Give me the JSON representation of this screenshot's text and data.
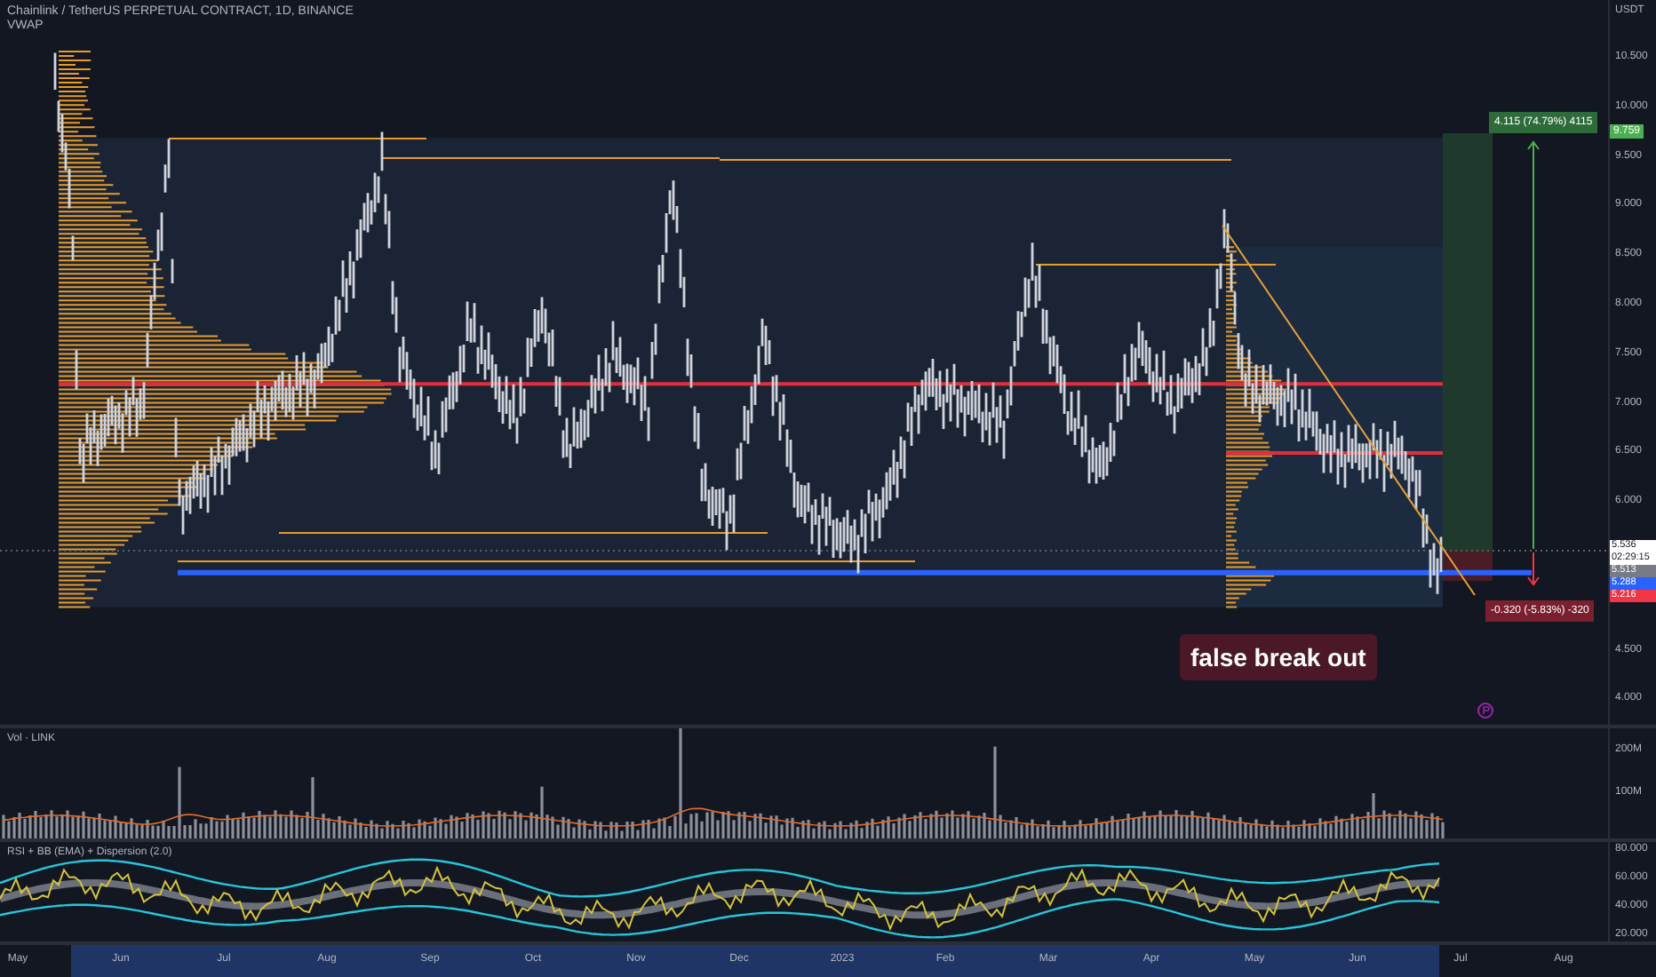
{
  "header": {
    "title": "Chainlink / TetherUS PERPETUAL CONTRACT, 1D, BINANCE",
    "indicator": "VWAP"
  },
  "price_axis": {
    "unit": "USDT",
    "ticks": [
      "10.500",
      "10.000",
      "9.500",
      "9.000",
      "8.500",
      "8.000",
      "7.500",
      "7.000",
      "6.500",
      "6.000",
      "4.500",
      "4.000"
    ]
  },
  "target_tag": {
    "text": "9.759",
    "color": "#4caf50"
  },
  "price_tags": [
    {
      "text": "5.536",
      "subtext": "02:29:15",
      "color": "#ffffff"
    },
    {
      "text": "5.513",
      "color": "#787b86"
    },
    {
      "text": "5.288",
      "color": "#2962ff"
    },
    {
      "text": "5.216",
      "color": "#f23645"
    }
  ],
  "measure": {
    "gain_label": "4.115 (74.79%) 4115",
    "loss_label": "-0.320 (-5.83%) -320"
  },
  "annotation": {
    "text": "false break out"
  },
  "volume_pane": {
    "title": "Vol · LINK",
    "ticks": [
      "200M",
      "100M"
    ]
  },
  "rsi_pane": {
    "title": "RSI + BB (EMA) + Dispersion (2.0)",
    "ticks": [
      "80.000",
      "60.000",
      "40.000",
      "20.000"
    ]
  },
  "time_axis": {
    "labels": [
      "May",
      "Jun",
      "Jul",
      "Aug",
      "Sep",
      "Oct",
      "Nov",
      "Dec",
      "2023",
      "Feb",
      "Mar",
      "Apr",
      "May",
      "Jun",
      "Jul",
      "Aug"
    ]
  }
}
